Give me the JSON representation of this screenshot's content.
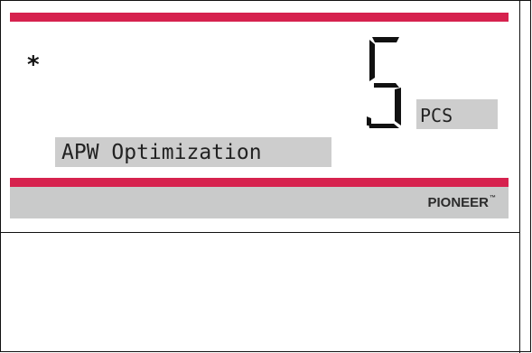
{
  "display": {
    "indicator": "*",
    "reading": "5",
    "unit": "PCS",
    "mode_label": "APW Optimization"
  },
  "brand": {
    "name": "PIONEER",
    "trademark": "™"
  },
  "colors": {
    "accent_red": "#d6224e",
    "footer_gray": "#c9caca",
    "label_gray": "#cdcdcd"
  }
}
